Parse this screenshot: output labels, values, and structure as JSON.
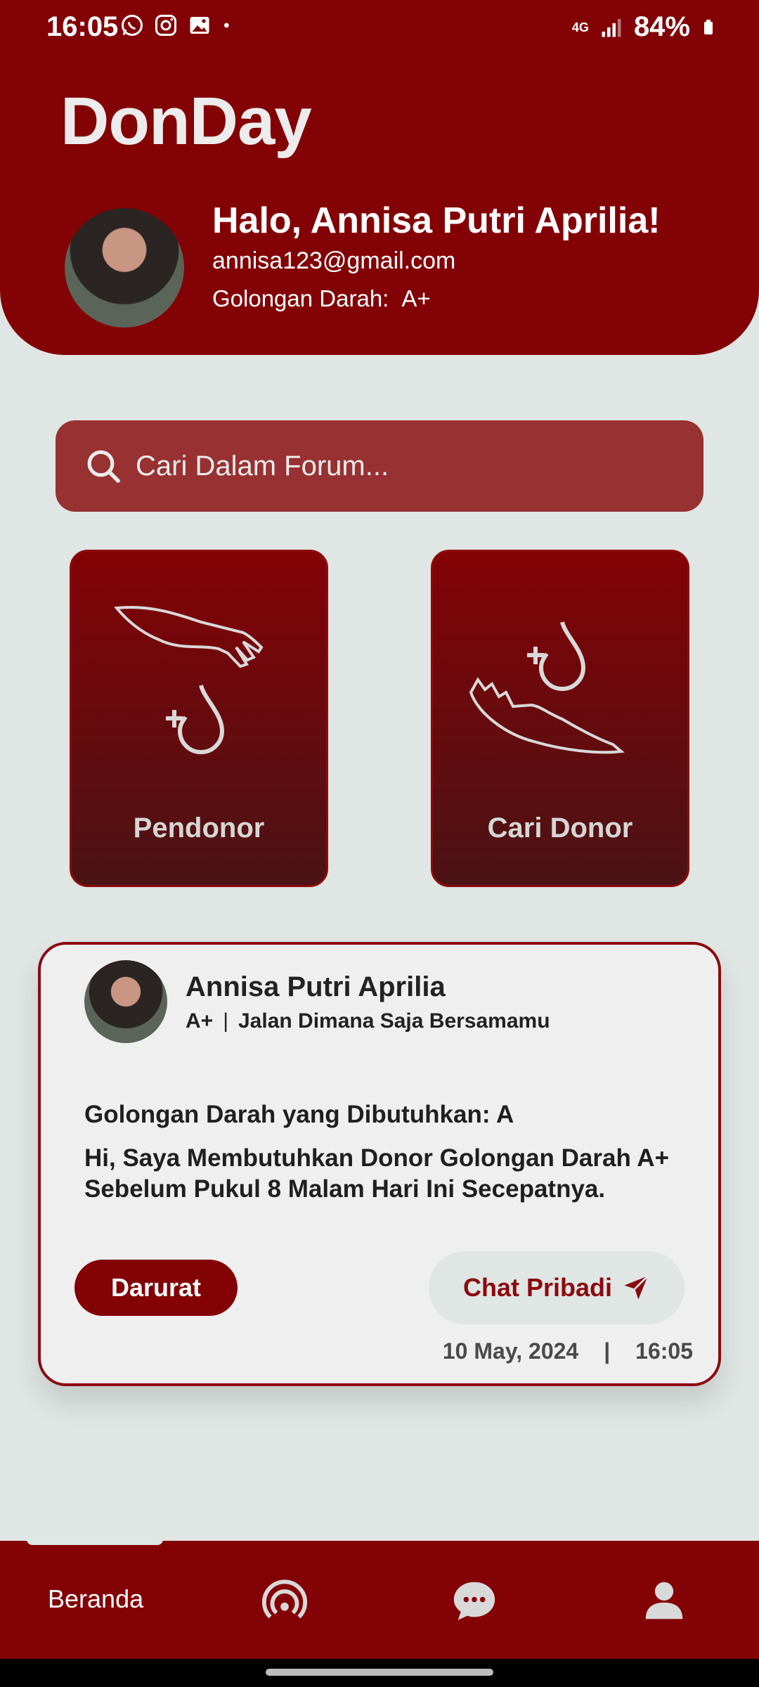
{
  "status_bar": {
    "time": "16:05",
    "notification_icons": [
      "whatsapp-icon",
      "instagram-icon",
      "gallery-icon",
      "dot-icon"
    ],
    "network": "4G",
    "battery": "84%"
  },
  "header": {
    "app_title": "DonDay",
    "greeting": "Halo, Annisa Putri Aprilia!",
    "email": "annisa123@gmail.com",
    "blood_label": "Golongan Darah:",
    "blood_value": "A+"
  },
  "search": {
    "placeholder": "Cari Dalam Forum..."
  },
  "actions": [
    {
      "label": "Pendonor",
      "icon": "donate-hand-drop-icon"
    },
    {
      "label": "Cari Donor",
      "icon": "receive-hand-drop-icon"
    }
  ],
  "post": {
    "author": "Annisa Putri Aprilia",
    "blood_type": "A+",
    "separator": "|",
    "location": "Jalan Dimana Saja Bersamamu",
    "need_label": "Golongan Darah yang Dibutuhkan: A",
    "body": "Hi, Saya Membutuhkan Donor Golongan Darah A+ Sebelum Pukul 8 Malam Hari Ini Secepatnya.",
    "urgent_label": "Darurat",
    "chat_label": "Chat Pribadi",
    "date": "10 May, 2024",
    "time": "16:05"
  },
  "bottom_nav": {
    "home_label": "Beranda",
    "items": [
      "broadcast-icon",
      "chat-bubble-icon",
      "profile-icon"
    ]
  },
  "colors": {
    "primary": "#830206",
    "background": "#dfe6e3",
    "search_bg": "#983132",
    "card_bg": "#efefef"
  }
}
